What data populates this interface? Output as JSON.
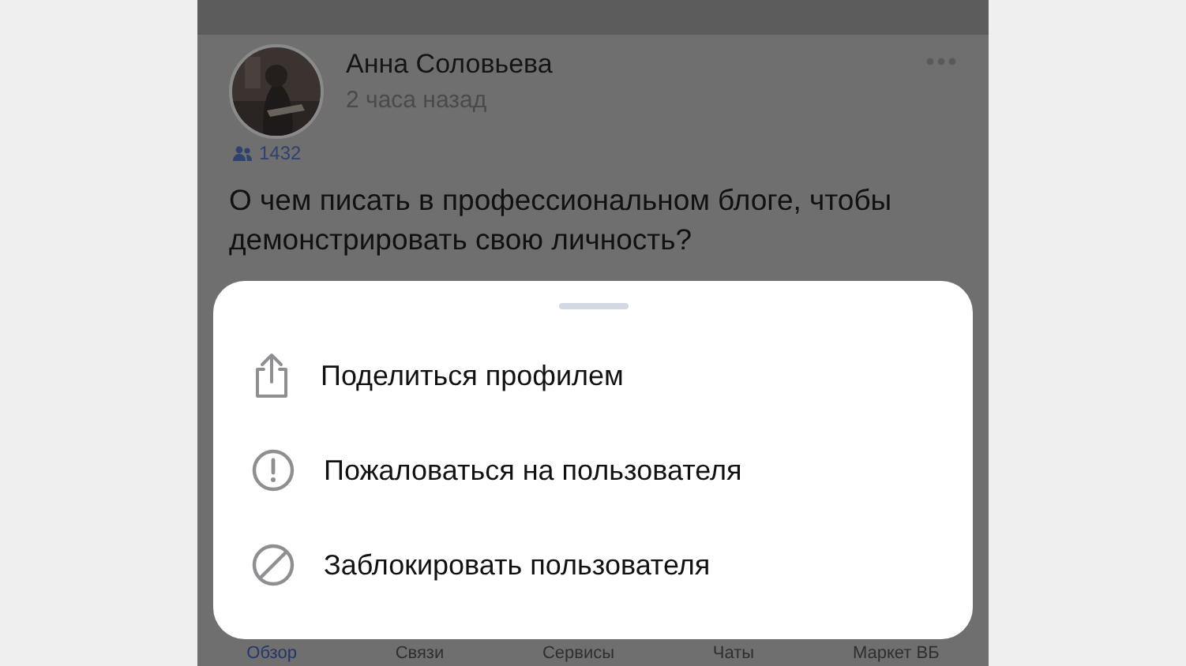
{
  "post": {
    "author": "Анна Соловьева",
    "time": "2 часа назад",
    "followers": "1432",
    "text": "О чем писать в профессиональном блоге, чтобы демонстрировать свою личность?"
  },
  "sheet": {
    "items": [
      {
        "kind": "share",
        "label": "Поделиться профилем"
      },
      {
        "kind": "report",
        "label": "Пожаловаться на пользователя"
      },
      {
        "kind": "block",
        "label": "Заблокировать пользователя"
      }
    ]
  },
  "nav": [
    {
      "label": "Обзор",
      "selected": true
    },
    {
      "label": "Связи",
      "selected": false
    },
    {
      "label": "Сервисы",
      "selected": false
    },
    {
      "label": "Чаты",
      "selected": false
    },
    {
      "label": "Маркет ВБ",
      "selected": false
    }
  ]
}
